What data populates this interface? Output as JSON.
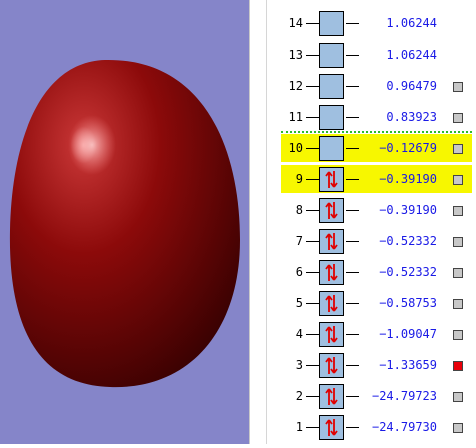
{
  "viewport": {
    "background": "#8585c9",
    "surface_color": "#8c0a0a"
  },
  "orbitals": [
    {
      "index": "14",
      "energy": "1.06244",
      "occupied": false,
      "highlighted": false,
      "show_checkbox": false,
      "checked": false
    },
    {
      "index": "13",
      "energy": "1.06244",
      "occupied": false,
      "highlighted": false,
      "show_checkbox": false,
      "checked": false
    },
    {
      "index": "12",
      "energy": "0.96479",
      "occupied": false,
      "highlighted": false,
      "show_checkbox": true,
      "checked": false
    },
    {
      "index": "11",
      "energy": "0.83923",
      "occupied": false,
      "highlighted": false,
      "show_checkbox": true,
      "checked": false
    },
    {
      "index": "10",
      "energy": "−0.12679",
      "occupied": false,
      "highlighted": true,
      "show_checkbox": true,
      "checked": false
    },
    {
      "index": "9",
      "energy": "−0.39190",
      "occupied": true,
      "highlighted": true,
      "show_checkbox": true,
      "checked": false
    },
    {
      "index": "8",
      "energy": "−0.39190",
      "occupied": true,
      "highlighted": false,
      "show_checkbox": true,
      "checked": false
    },
    {
      "index": "7",
      "energy": "−0.52332",
      "occupied": true,
      "highlighted": false,
      "show_checkbox": true,
      "checked": false
    },
    {
      "index": "6",
      "energy": "−0.52332",
      "occupied": true,
      "highlighted": false,
      "show_checkbox": true,
      "checked": false
    },
    {
      "index": "5",
      "energy": "−0.58753",
      "occupied": true,
      "highlighted": false,
      "show_checkbox": true,
      "checked": false
    },
    {
      "index": "4",
      "energy": "−1.09047",
      "occupied": true,
      "highlighted": false,
      "show_checkbox": true,
      "checked": false
    },
    {
      "index": "3",
      "energy": "−1.33659",
      "occupied": true,
      "highlighted": false,
      "show_checkbox": true,
      "checked": true
    },
    {
      "index": "2",
      "energy": "−24.79723",
      "occupied": true,
      "highlighted": false,
      "show_checkbox": true,
      "checked": false
    },
    {
      "index": "1",
      "energy": "−24.79730",
      "occupied": true,
      "highlighted": false,
      "show_checkbox": true,
      "checked": false
    }
  ],
  "colors": {
    "highlight": "#f7f700",
    "energy_text": "#1a1ae6",
    "orbital_box": "#9fbfe0",
    "electron_arrow": "#e00000",
    "checked": "#e8000a",
    "homo_lumo_separator": "#2dbb2d"
  },
  "icons": {
    "electron_pair": "spin-up-down-arrows-icon"
  }
}
